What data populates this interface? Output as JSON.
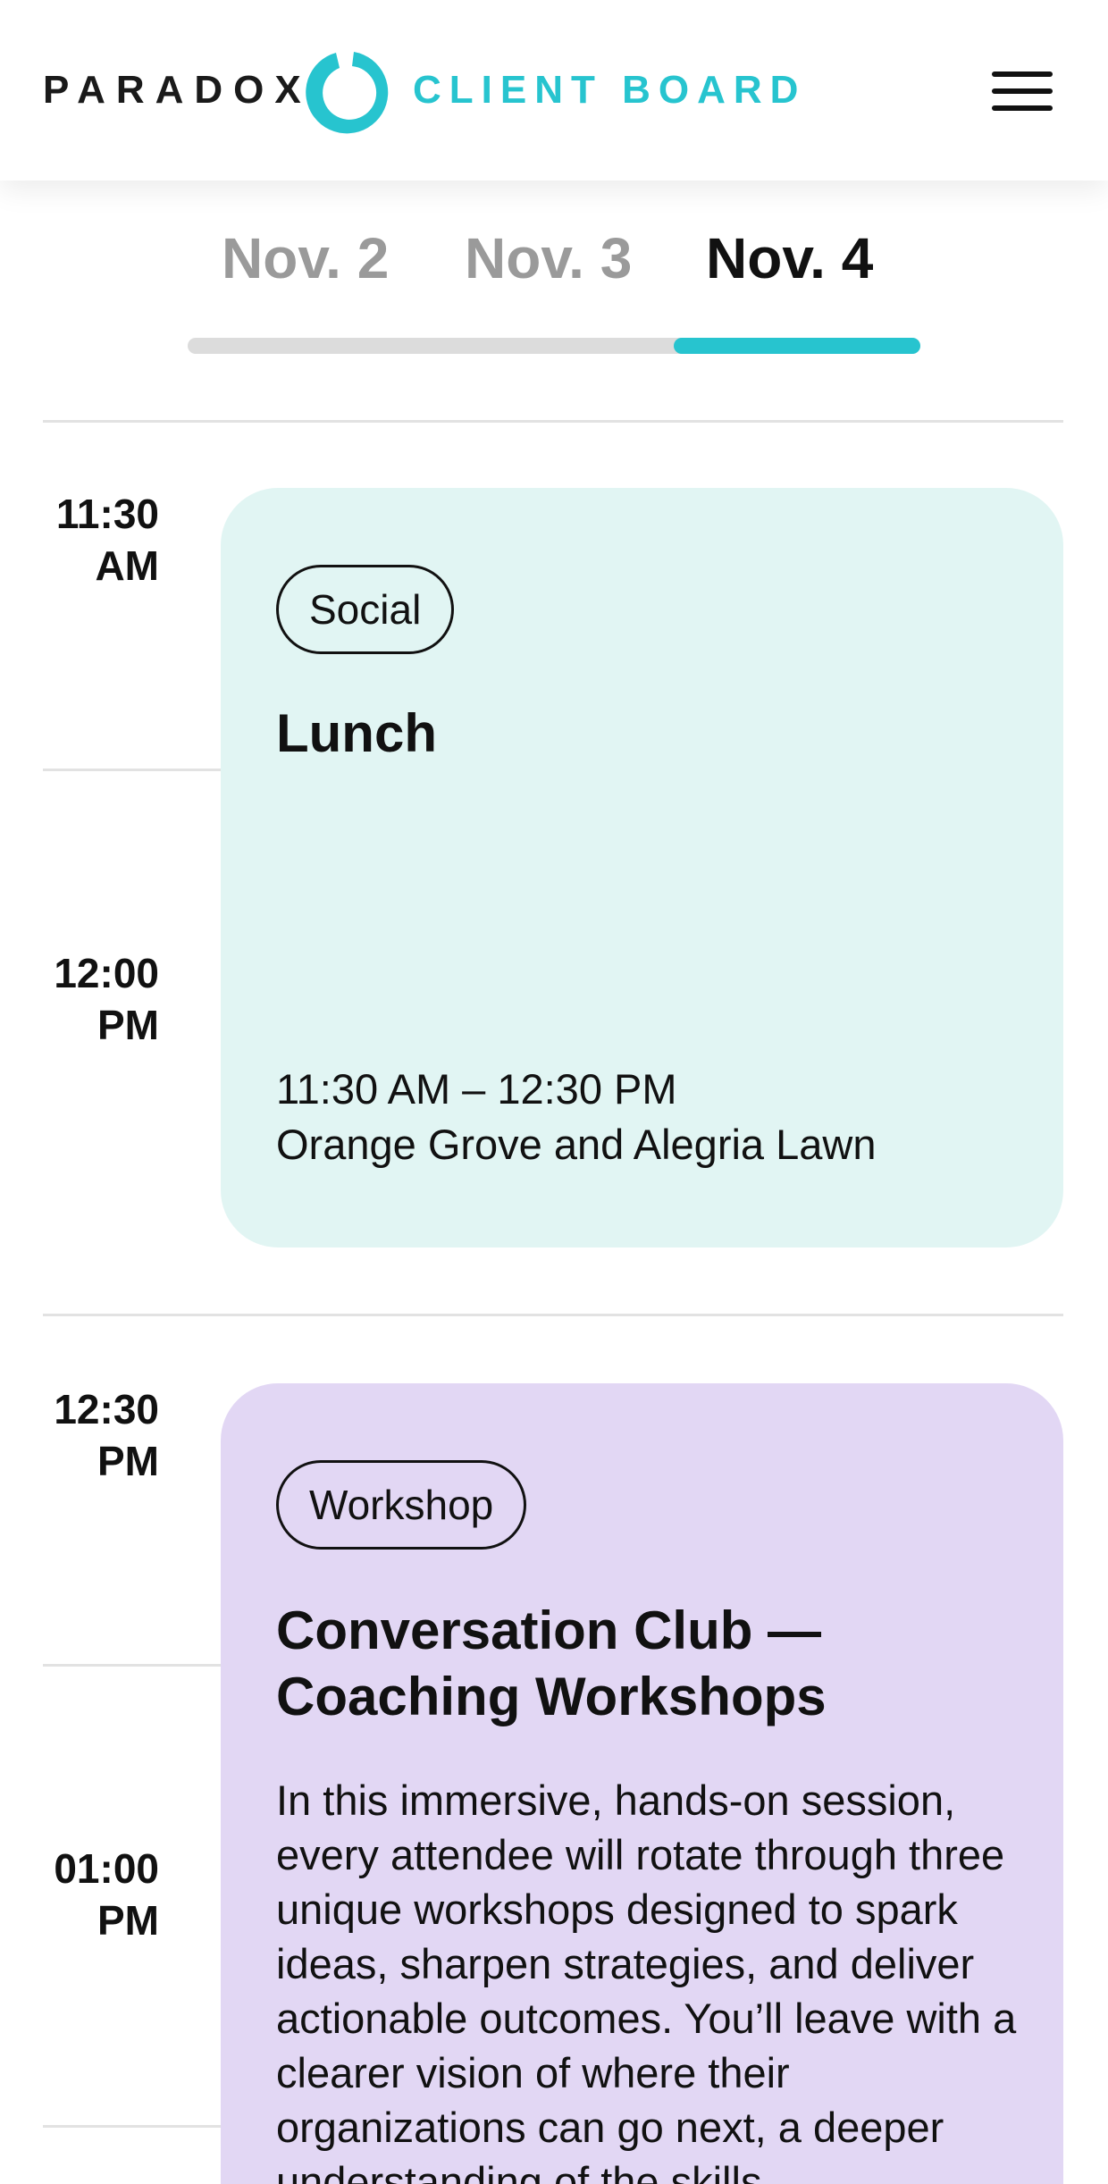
{
  "header": {
    "brand_left": "PARADOX",
    "brand_right": "CLIENT BOARD",
    "menu_icon": "hamburger-icon",
    "brand_color": "#27c4cf"
  },
  "days": {
    "tabs": [
      {
        "label": "Nov. 2",
        "active": false
      },
      {
        "label": "Nov. 3",
        "active": false
      },
      {
        "label": "Nov. 4",
        "active": true
      }
    ]
  },
  "timeline": {
    "slots": [
      {
        "hour": "11:30",
        "period": "AM"
      },
      {
        "hour": "12:00",
        "period": "PM"
      },
      {
        "hour": "12:30",
        "period": "PM"
      },
      {
        "hour": "01:00",
        "period": "PM"
      }
    ]
  },
  "events": [
    {
      "category": "Social",
      "title": "Lunch",
      "time_range": "11:30 AM – 12:30 PM",
      "location": "Orange Grove and Alegria Lawn",
      "color": "#e1f5f3"
    },
    {
      "category": "Workshop",
      "title": "Conversation Club — Coaching Workshops",
      "description": "In this immersive, hands-on session, every attendee will rotate through three unique workshops designed to spark ideas, sharpen strategies, and deliver actionable outcomes. You’ll leave with a clearer vision of where their organizations can go next, a deeper understanding of the skills",
      "color": "#e2d7f4"
    }
  ]
}
